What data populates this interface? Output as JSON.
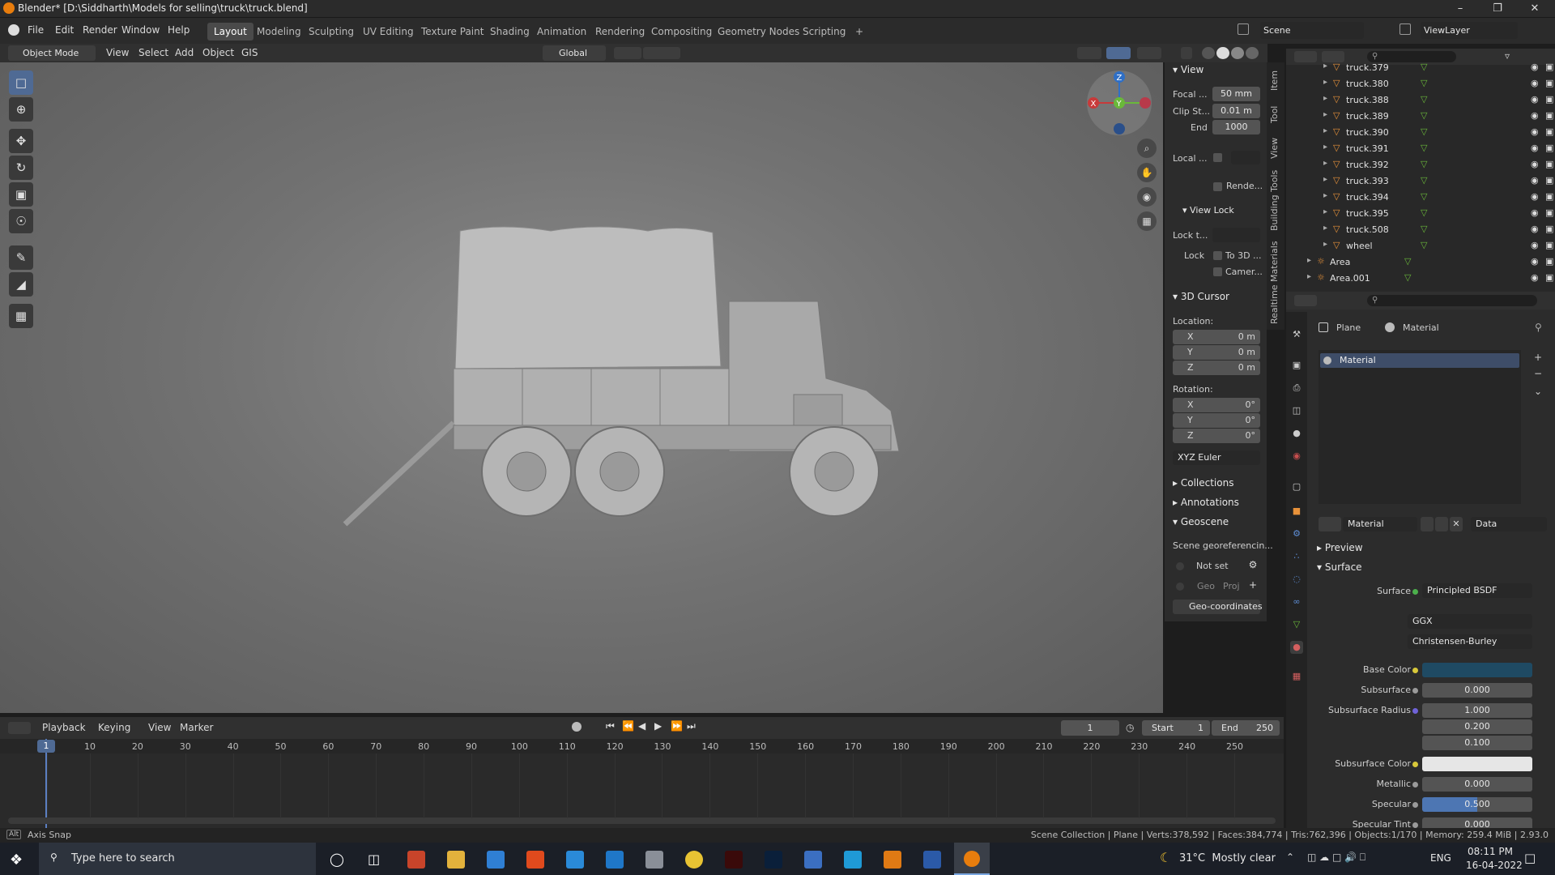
{
  "title": "Blender* [D:\\Siddharth\\Models for selling\\truck\\truck.blend]",
  "menu": [
    "File",
    "Edit",
    "Render",
    "Window",
    "Help"
  ],
  "workspaces": [
    "Layout",
    "Modeling",
    "Sculpting",
    "UV Editing",
    "Texture Paint",
    "Shading",
    "Animation",
    "Rendering",
    "Compositing",
    "Geometry Nodes",
    "Scripting"
  ],
  "active_workspace": "Layout",
  "scene": "Scene",
  "view_layer": "ViewLayer",
  "header3d": {
    "mode": "Object Mode",
    "menus": [
      "View",
      "Select",
      "Add",
      "Object",
      "GIS"
    ],
    "orientation": "Global"
  },
  "npanel": {
    "tabs": [
      "Item",
      "Tool",
      "View",
      "Building Tools",
      "Realtime Materials"
    ],
    "view_title": "View",
    "focal_label": "Focal ...",
    "focal": "50 mm",
    "clip_start_label": "Clip St...",
    "clip_start": "0.01 m",
    "end_label": "End",
    "end": "1000",
    "local_label": "Local ...",
    "render_label": "Rende...",
    "view_lock": "View Lock",
    "lock_to_label": "Lock t...",
    "lock_label": "Lock",
    "to3d": "To 3D ...",
    "camera": "Camer...",
    "cursor_title": "3D Cursor",
    "location": "Location:",
    "loc": [
      [
        "X",
        "0 m"
      ],
      [
        "Y",
        "0 m"
      ],
      [
        "Z",
        "0 m"
      ]
    ],
    "rotation": "Rotation:",
    "rot": [
      [
        "X",
        "0°"
      ],
      [
        "Y",
        "0°"
      ],
      [
        "Z",
        "0°"
      ]
    ],
    "euler": "XYZ Euler",
    "collections": "Collections",
    "annotations": "Annotations",
    "geoscene": "Geoscene",
    "georef": "Scene georeferencin...",
    "not_set": "Not set",
    "geo": "Geo",
    "proj": "Proj",
    "geocoords": "Geo-coordinates"
  },
  "outliner": {
    "items": [
      "truck.379",
      "truck.380",
      "truck.388",
      "truck.389",
      "truck.390",
      "truck.391",
      "truck.392",
      "truck.393",
      "truck.394",
      "truck.395",
      "truck.508",
      "wheel",
      "Area",
      "Area.001"
    ]
  },
  "properties": {
    "object": "Plane",
    "material_tab": "Material",
    "slot": "Material",
    "material_name": "Material",
    "data": "Data",
    "preview": "Preview",
    "surface_section": "Surface",
    "surface_label": "Surface",
    "surface_value": "Principled BSDF",
    "dist": "GGX",
    "sss_method": "Christensen-Burley",
    "rows": [
      {
        "label": "Base Color",
        "value": ""
      },
      {
        "label": "Subsurface",
        "value": "0.000"
      },
      {
        "label": "Subsurface Radius",
        "value": "1.000"
      },
      {
        "label": "",
        "value": "0.200"
      },
      {
        "label": "",
        "value": "0.100"
      },
      {
        "label": "Subsurface Color",
        "value": ""
      },
      {
        "label": "Metallic",
        "value": "0.000"
      },
      {
        "label": "Specular",
        "value": "0.500"
      },
      {
        "label": "Specular Tint",
        "value": "0.000"
      }
    ]
  },
  "timeline": {
    "menus": [
      "Playback",
      "Keying",
      "View",
      "Marker"
    ],
    "current_frame": "1",
    "start_label": "Start",
    "start": "1",
    "end_label": "End",
    "end": "250",
    "ticks": [
      "1",
      "10",
      "20",
      "30",
      "40",
      "50",
      "60",
      "70",
      "80",
      "90",
      "100",
      "110",
      "120",
      "130",
      "140",
      "150",
      "160",
      "170",
      "180",
      "190",
      "200",
      "210",
      "220",
      "230",
      "240",
      "250"
    ]
  },
  "status": {
    "left": "Axis Snap",
    "right": "Scene Collection | Plane | Verts:378,592 | Faces:384,774 | Tris:762,396 | Objects:1/170 | Memory: 259.4 MiB | 2.93.0"
  },
  "taskbar": {
    "search": "Type here to search",
    "weather": "31°C  Mostly clear",
    "lang": "ENG",
    "time": "08:11 PM",
    "date": "16-04-2022"
  },
  "colors": {
    "accent": "#4f6a94",
    "base_color": "#1f4a63",
    "specular_fill": "#4d76b3"
  }
}
